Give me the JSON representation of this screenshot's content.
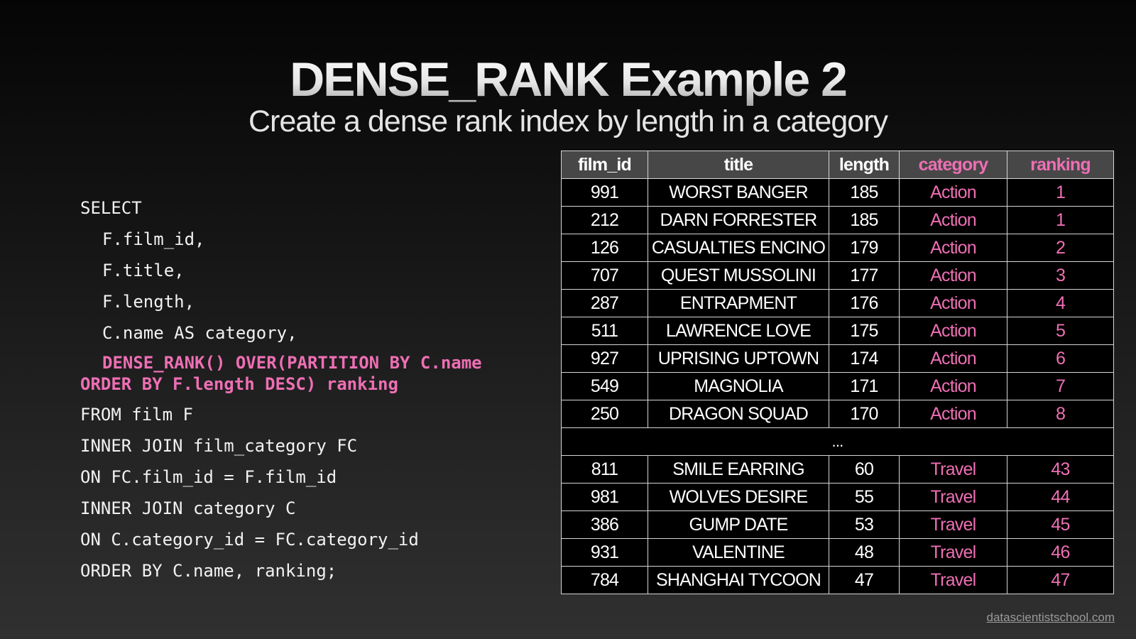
{
  "slide": {
    "title": "DENSE_RANK Example 2",
    "subtitle": "Create a dense rank index by length in a category"
  },
  "code": {
    "line1": "SELECT",
    "line2": "F.film_id,",
    "line3": "F.title,",
    "line4": "F.length,",
    "line5": "C.name AS category,",
    "highlight_line1": "DENSE_RANK() OVER(PARTITION BY C.name",
    "highlight_line2": "ORDER BY F.length DESC) ranking",
    "line6": "FROM film F",
    "line7": "INNER JOIN film_category FC",
    "line8": "ON FC.film_id = F.film_id",
    "line9": "INNER JOIN category C",
    "line10": "ON C.category_id = FC.category_id",
    "line11": "ORDER BY C.name, ranking;"
  },
  "table": {
    "headers": [
      "film_id",
      "title",
      "length",
      "category",
      "ranking"
    ],
    "top_rows": [
      [
        "991",
        "WORST BANGER",
        "185",
        "Action",
        "1"
      ],
      [
        "212",
        "DARN FORRESTER",
        "185",
        "Action",
        "1"
      ],
      [
        "126",
        "CASUALTIES ENCINO",
        "179",
        "Action",
        "2"
      ],
      [
        "707",
        "QUEST MUSSOLINI",
        "177",
        "Action",
        "3"
      ],
      [
        "287",
        "ENTRAPMENT",
        "176",
        "Action",
        "4"
      ],
      [
        "511",
        "LAWRENCE LOVE",
        "175",
        "Action",
        "5"
      ],
      [
        "927",
        "UPRISING UPTOWN",
        "174",
        "Action",
        "6"
      ],
      [
        "549",
        "MAGNOLIA",
        "171",
        "Action",
        "7"
      ],
      [
        "250",
        "DRAGON SQUAD",
        "170",
        "Action",
        "8"
      ]
    ],
    "ellipsis": "...",
    "bottom_rows": [
      [
        "811",
        "SMILE EARRING",
        "60",
        "Travel",
        "43"
      ],
      [
        "981",
        "WOLVES DESIRE",
        "55",
        "Travel",
        "44"
      ],
      [
        "386",
        "GUMP DATE",
        "53",
        "Travel",
        "45"
      ],
      [
        "931",
        "VALENTINE",
        "48",
        "Travel",
        "46"
      ],
      [
        "784",
        "SHANGHAI TYCOON",
        "47",
        "Travel",
        "47"
      ]
    ]
  },
  "footer": {
    "link": "datascientistschool.com"
  },
  "colors": {
    "accent": "#ee6fb4",
    "header_bg": "#474747",
    "cell_bg": "#000000"
  }
}
